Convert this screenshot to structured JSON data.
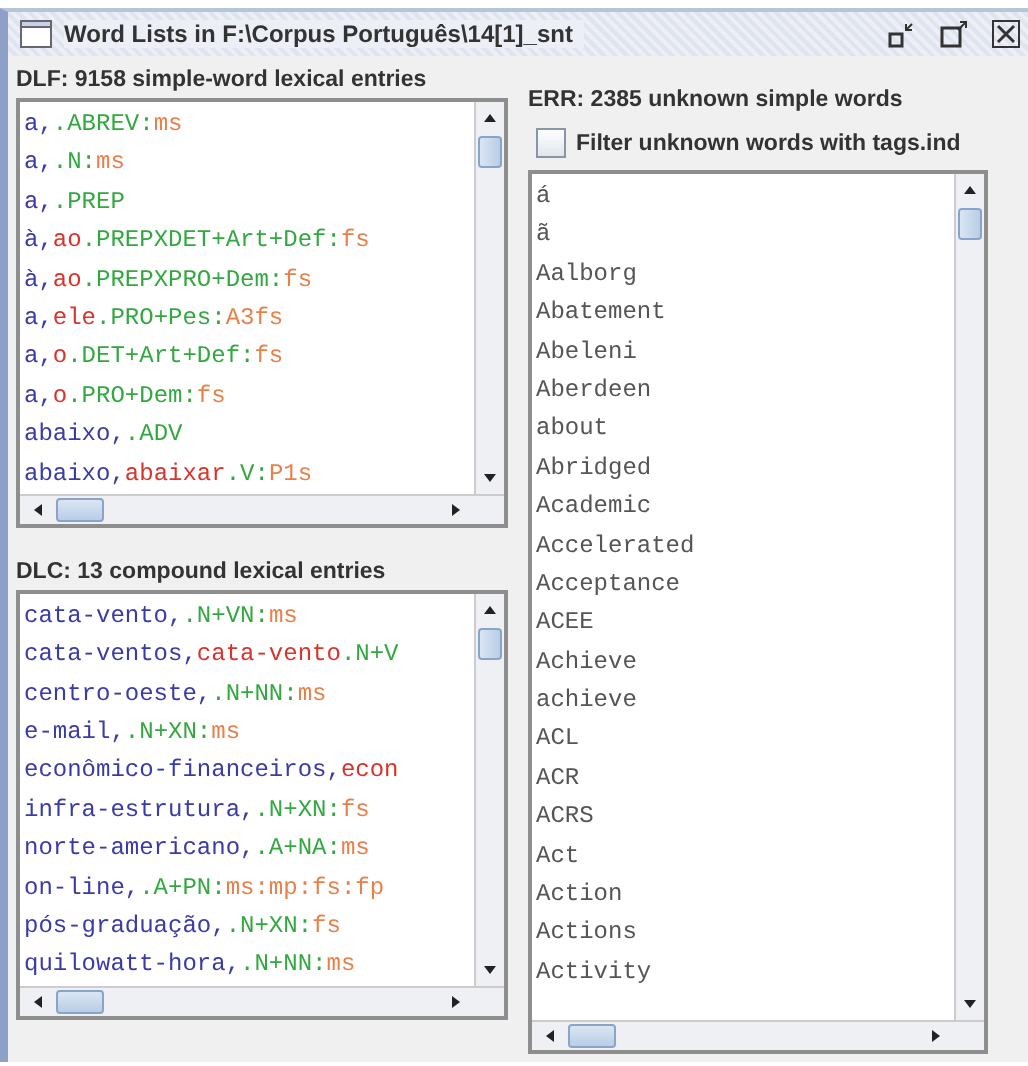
{
  "window": {
    "title": "Word Lists in F:\\Corpus Português\\14[1]_snt"
  },
  "dlf": {
    "label": "DLF: 9158 simple-word lexical entries",
    "entries": [
      {
        "segments": [
          {
            "kind": "form",
            "text": "a,"
          },
          {
            "kind": "code",
            "text": ".ABREV:"
          },
          {
            "kind": "infl",
            "text": "ms"
          }
        ]
      },
      {
        "segments": [
          {
            "kind": "form",
            "text": "a,"
          },
          {
            "kind": "code",
            "text": ".N:"
          },
          {
            "kind": "infl",
            "text": "ms"
          }
        ]
      },
      {
        "segments": [
          {
            "kind": "form",
            "text": "a,"
          },
          {
            "kind": "code",
            "text": ".PREP"
          }
        ]
      },
      {
        "segments": [
          {
            "kind": "form",
            "text": "à,"
          },
          {
            "kind": "lemma",
            "text": "ao"
          },
          {
            "kind": "code",
            "text": ".PREPXDET+Art+Def:"
          },
          {
            "kind": "infl",
            "text": "fs"
          }
        ]
      },
      {
        "segments": [
          {
            "kind": "form",
            "text": "à,"
          },
          {
            "kind": "lemma",
            "text": "ao"
          },
          {
            "kind": "code",
            "text": ".PREPXPRO+Dem:"
          },
          {
            "kind": "infl",
            "text": "fs"
          }
        ]
      },
      {
        "segments": [
          {
            "kind": "form",
            "text": "a,"
          },
          {
            "kind": "lemma",
            "text": "ele"
          },
          {
            "kind": "code",
            "text": ".PRO+Pes:"
          },
          {
            "kind": "infl",
            "text": "A3fs"
          }
        ]
      },
      {
        "segments": [
          {
            "kind": "form",
            "text": "a,"
          },
          {
            "kind": "lemma",
            "text": "o"
          },
          {
            "kind": "code",
            "text": ".DET+Art+Def:"
          },
          {
            "kind": "infl",
            "text": "fs"
          }
        ]
      },
      {
        "segments": [
          {
            "kind": "form",
            "text": "a,"
          },
          {
            "kind": "lemma",
            "text": "o"
          },
          {
            "kind": "code",
            "text": ".PRO+Dem:"
          },
          {
            "kind": "infl",
            "text": "fs"
          }
        ]
      },
      {
        "segments": [
          {
            "kind": "form",
            "text": "abaixo,"
          },
          {
            "kind": "code",
            "text": ".ADV"
          }
        ]
      },
      {
        "segments": [
          {
            "kind": "form",
            "text": "abaixo,"
          },
          {
            "kind": "lemma",
            "text": "abaixar"
          },
          {
            "kind": "code",
            "text": ".V:"
          },
          {
            "kind": "infl",
            "text": "P1s"
          }
        ]
      }
    ]
  },
  "dlc": {
    "label": "DLC: 13 compound lexical entries",
    "entries": [
      {
        "segments": [
          {
            "kind": "form",
            "text": "cata-vento,"
          },
          {
            "kind": "code",
            "text": ".N+VN:"
          },
          {
            "kind": "infl",
            "text": "ms"
          }
        ]
      },
      {
        "segments": [
          {
            "kind": "form",
            "text": "cata-ventos,"
          },
          {
            "kind": "lemma",
            "text": "cata-vento"
          },
          {
            "kind": "code",
            "text": ".N+V"
          }
        ]
      },
      {
        "segments": [
          {
            "kind": "form",
            "text": "centro-oeste,"
          },
          {
            "kind": "code",
            "text": ".N+NN:"
          },
          {
            "kind": "infl",
            "text": "ms"
          }
        ]
      },
      {
        "segments": [
          {
            "kind": "form",
            "text": "e-mail,"
          },
          {
            "kind": "code",
            "text": ".N+XN:"
          },
          {
            "kind": "infl",
            "text": "ms"
          }
        ]
      },
      {
        "segments": [
          {
            "kind": "form",
            "text": "econômico-financeiros,"
          },
          {
            "kind": "lemma",
            "text": "econ"
          }
        ]
      },
      {
        "segments": [
          {
            "kind": "form",
            "text": "infra-estrutura,"
          },
          {
            "kind": "code",
            "text": ".N+XN:"
          },
          {
            "kind": "infl",
            "text": "fs"
          }
        ]
      },
      {
        "segments": [
          {
            "kind": "form",
            "text": "norte-americano,"
          },
          {
            "kind": "code",
            "text": ".A+NA:"
          },
          {
            "kind": "infl",
            "text": "ms"
          }
        ]
      },
      {
        "segments": [
          {
            "kind": "form",
            "text": "on-line,"
          },
          {
            "kind": "code",
            "text": ".A+PN:"
          },
          {
            "kind": "infl",
            "text": "ms:mp:fs:fp"
          }
        ]
      },
      {
        "segments": [
          {
            "kind": "form",
            "text": "pós-graduação,"
          },
          {
            "kind": "code",
            "text": ".N+XN:"
          },
          {
            "kind": "infl",
            "text": "fs"
          }
        ]
      },
      {
        "segments": [
          {
            "kind": "form",
            "text": "quilowatt-hora,"
          },
          {
            "kind": "code",
            "text": ".N+NN:"
          },
          {
            "kind": "infl",
            "text": "ms"
          }
        ]
      }
    ]
  },
  "err": {
    "label": "ERR: 2385 unknown simple words",
    "filter": {
      "label": "Filter unknown words with tags.ind",
      "checked": false
    },
    "words": [
      "á",
      "ã",
      "Aalborg",
      "Abatement",
      "Abeleni",
      "Aberdeen",
      "about",
      "Abridged",
      "Academic",
      "Accelerated",
      "Acceptance",
      "ACEE",
      "Achieve",
      "achieve",
      "ACL",
      "ACR",
      "ACRS",
      "Act",
      "Action",
      "Actions",
      "Activity"
    ]
  }
}
